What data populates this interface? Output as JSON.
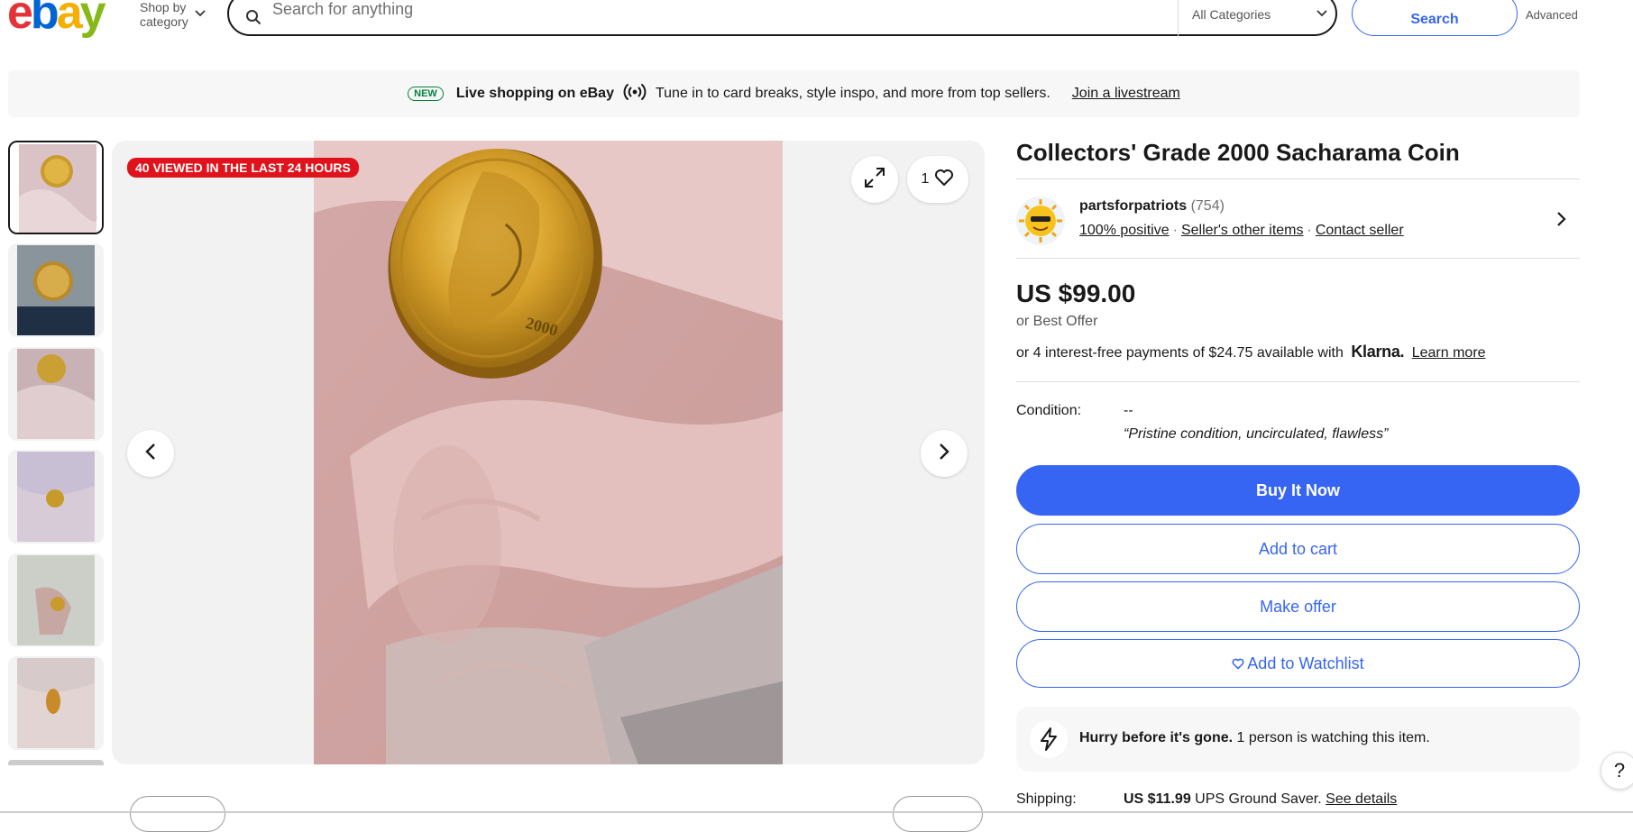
{
  "header": {
    "logo_letters": [
      "e",
      "b",
      "a",
      "y"
    ],
    "shop_by_line1": "Shop by",
    "shop_by_line2": "category",
    "search_placeholder": "Search for anything",
    "category_select": "All Categories",
    "search_button": "Search",
    "advanced_link": "Advanced"
  },
  "banner": {
    "badge": "NEW",
    "title": "Live shopping on eBay",
    "text": "Tune in to card breaks, style inspo, and more from top sellers.",
    "link": "Join a livestream"
  },
  "gallery": {
    "thumbnail_count": 6,
    "selected_index": 0,
    "viewed_badge": "40 VIEWED IN THE LAST 24 HOURS",
    "watch_count": "1"
  },
  "listing": {
    "title": "Collectors' Grade 2000 Sacharama Coin",
    "seller": {
      "name": "partsforpatriots",
      "feedback_count": "(754)",
      "positive": "100% positive",
      "other_items": "Seller's other items",
      "contact": "Contact seller"
    },
    "price": "US $99.00",
    "best_offer": "or Best Offer",
    "klarna": {
      "prefix": "or 4 interest-free payments of $24.75 available with",
      "logo": "Klarna.",
      "learn_more": "Learn more"
    },
    "condition": {
      "label": "Condition:",
      "value": "--",
      "note": "“Pristine condition, uncirculated, flawless”"
    },
    "buttons": {
      "buy_now": "Buy It Now",
      "add_to_cart": "Add to cart",
      "make_offer": "Make offer",
      "watchlist": "Add to Watchlist"
    },
    "hurry": {
      "bold": "Hurry before it's gone.",
      "text": " 1 person is watching this item."
    },
    "shipping": {
      "label": "Shipping:",
      "price": "US $11.99",
      "service": " UPS Ground Saver. ",
      "details_link": "See details"
    }
  },
  "help_label": "?",
  "colors": {
    "brand_blue": "#3665f3",
    "badge_red": "#e0121b",
    "new_green": "#05823f"
  }
}
